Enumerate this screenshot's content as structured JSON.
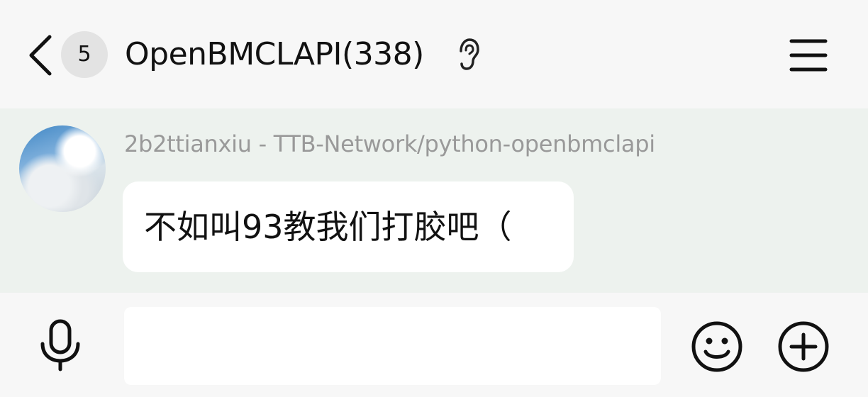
{
  "header": {
    "unread_count": "5",
    "title": "OpenBMCLAPI(338)",
    "icons": {
      "back": "chevron-left-icon",
      "mode": "ear-icon",
      "menu": "menu-icon"
    }
  },
  "messages": [
    {
      "sender": "2b2ttianxiu - TTB-Network/python-openbmclapi",
      "text": "不如叫93教我们打胶吧（"
    }
  ],
  "input_bar": {
    "value": "",
    "placeholder": "",
    "icons": {
      "voice": "microphone-icon",
      "emoji": "smiley-icon",
      "more": "plus-circle-icon"
    }
  },
  "colors": {
    "header_bg": "#f7f7f7",
    "message_area_bg": "#edf2ee",
    "bubble_bg": "#ffffff",
    "sender_text": "#999999",
    "badge_bg": "#e3e3e3"
  }
}
